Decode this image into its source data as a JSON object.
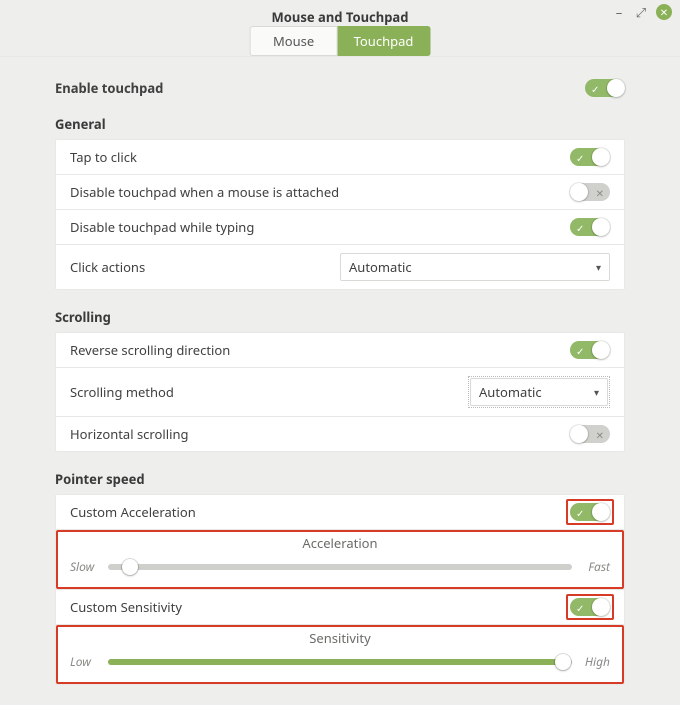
{
  "window": {
    "title": "Mouse and Touchpad"
  },
  "tabs": {
    "mouse": "Mouse",
    "touchpad": "Touchpad",
    "active": "touchpad"
  },
  "enable": {
    "label": "Enable touchpad",
    "on": true
  },
  "sections": {
    "general": {
      "title": "General",
      "tap_to_click": {
        "label": "Tap to click",
        "on": true
      },
      "disable_on_mouse": {
        "label": "Disable touchpad when a mouse is attached",
        "on": false
      },
      "disable_while_typing": {
        "label": "Disable touchpad while typing",
        "on": true
      },
      "click_actions": {
        "label": "Click actions",
        "value": "Automatic"
      }
    },
    "scrolling": {
      "title": "Scrolling",
      "reverse": {
        "label": "Reverse scrolling direction",
        "on": true
      },
      "method": {
        "label": "Scrolling method",
        "value": "Automatic"
      },
      "horizontal": {
        "label": "Horizontal scrolling",
        "on": false
      }
    },
    "pointer": {
      "title": "Pointer speed",
      "custom_accel": {
        "label": "Custom Acceleration",
        "on": true
      },
      "accel_slider": {
        "title": "Acceleration",
        "low": "Slow",
        "high": "Fast",
        "value": 3
      },
      "custom_sens": {
        "label": "Custom Sensitivity",
        "on": true
      },
      "sens_slider": {
        "title": "Sensitivity",
        "low": "Low",
        "high": "High",
        "value": 98
      }
    }
  }
}
